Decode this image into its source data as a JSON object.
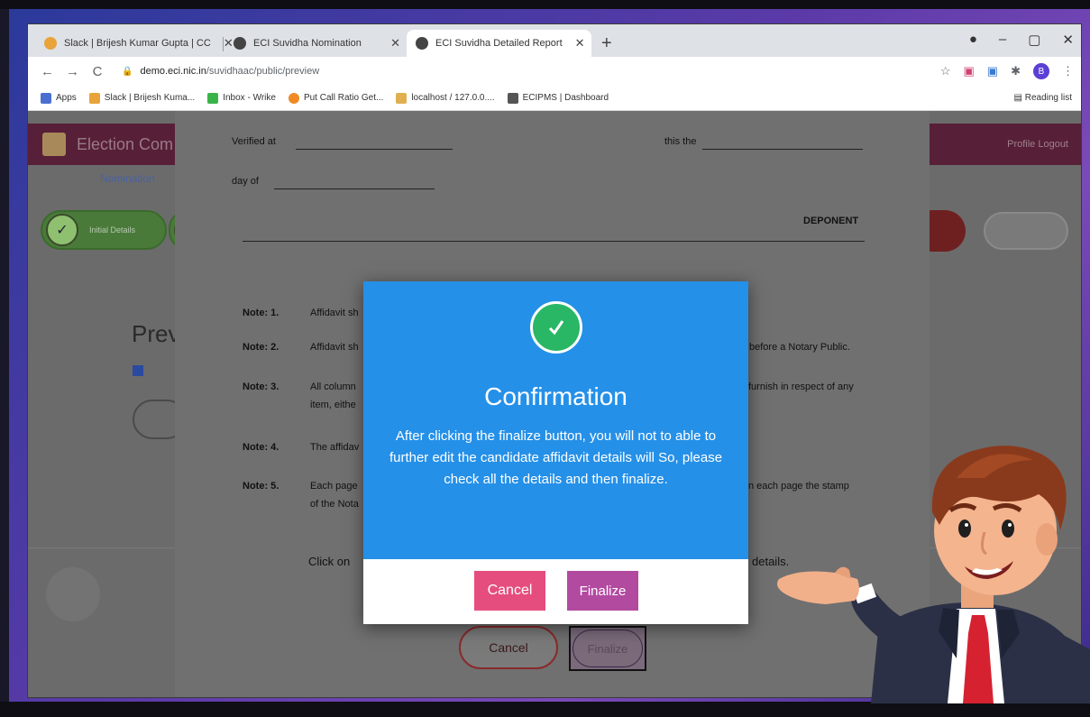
{
  "browser": {
    "tabs": [
      {
        "label": "Slack | Brijesh Kumar Gupta | CC",
        "active": false
      },
      {
        "label": "ECI Suvidha Nomination",
        "active": false
      },
      {
        "label": "ECI Suvidha Detailed Report",
        "active": true
      }
    ],
    "new_tab": "+",
    "url_host": "demo.eci.nic.in",
    "url_path": "/suvidhaac/public/preview",
    "bookmarks": [
      {
        "label": "Apps"
      },
      {
        "label": "Slack | Brijesh Kuma..."
      },
      {
        "label": "Inbox - Wrike"
      },
      {
        "label": "Put Call Ratio Get..."
      },
      {
        "label": "localhost / 127.0.0...."
      },
      {
        "label": "ECIPMS | Dashboard"
      }
    ],
    "reading_list": "Reading list",
    "profile_initial": "B"
  },
  "app": {
    "title": "Election Com",
    "nav_links": "Profile   Logout",
    "subnav": "Nomination",
    "step_text": "Initial Details",
    "preview_title": "Prev"
  },
  "document": {
    "verified_at": "Verified at",
    "this_the": "this the",
    "day_of": "day of",
    "deponent": "DEPONENT",
    "notes": [
      {
        "label": "Note: 1.",
        "text": "Affidavit sh"
      },
      {
        "label": "Note: 2.",
        "text": "Affidavit sh",
        "text_right": "before a Notary Public."
      },
      {
        "label": "Note: 3.",
        "text": "All column",
        "text2": "item, eithe",
        "text_right": "furnish in respect of any"
      },
      {
        "label": "Note: 4.",
        "text": "The affidav"
      },
      {
        "label": "Note: 5.",
        "text": "Each page",
        "text2": "of the Nota",
        "text_right": "n each page the stamp"
      }
    ],
    "click_on": "Click on",
    "details": "details."
  },
  "page_buttons": {
    "cancel": "Cancel",
    "finalize": "Finalize"
  },
  "modal": {
    "title": "Confirmation",
    "message": "After clicking the finalize button, you will not to able to further edit the candidate affidavit details will So, please check all the details and then finalize.",
    "cancel": "Cancel",
    "finalize": "Finalize"
  },
  "colors": {
    "modal_header": "#2590e8",
    "success_check": "#29b765",
    "cancel_button": "#e54d7e",
    "finalize_button": "#b24aa0"
  }
}
